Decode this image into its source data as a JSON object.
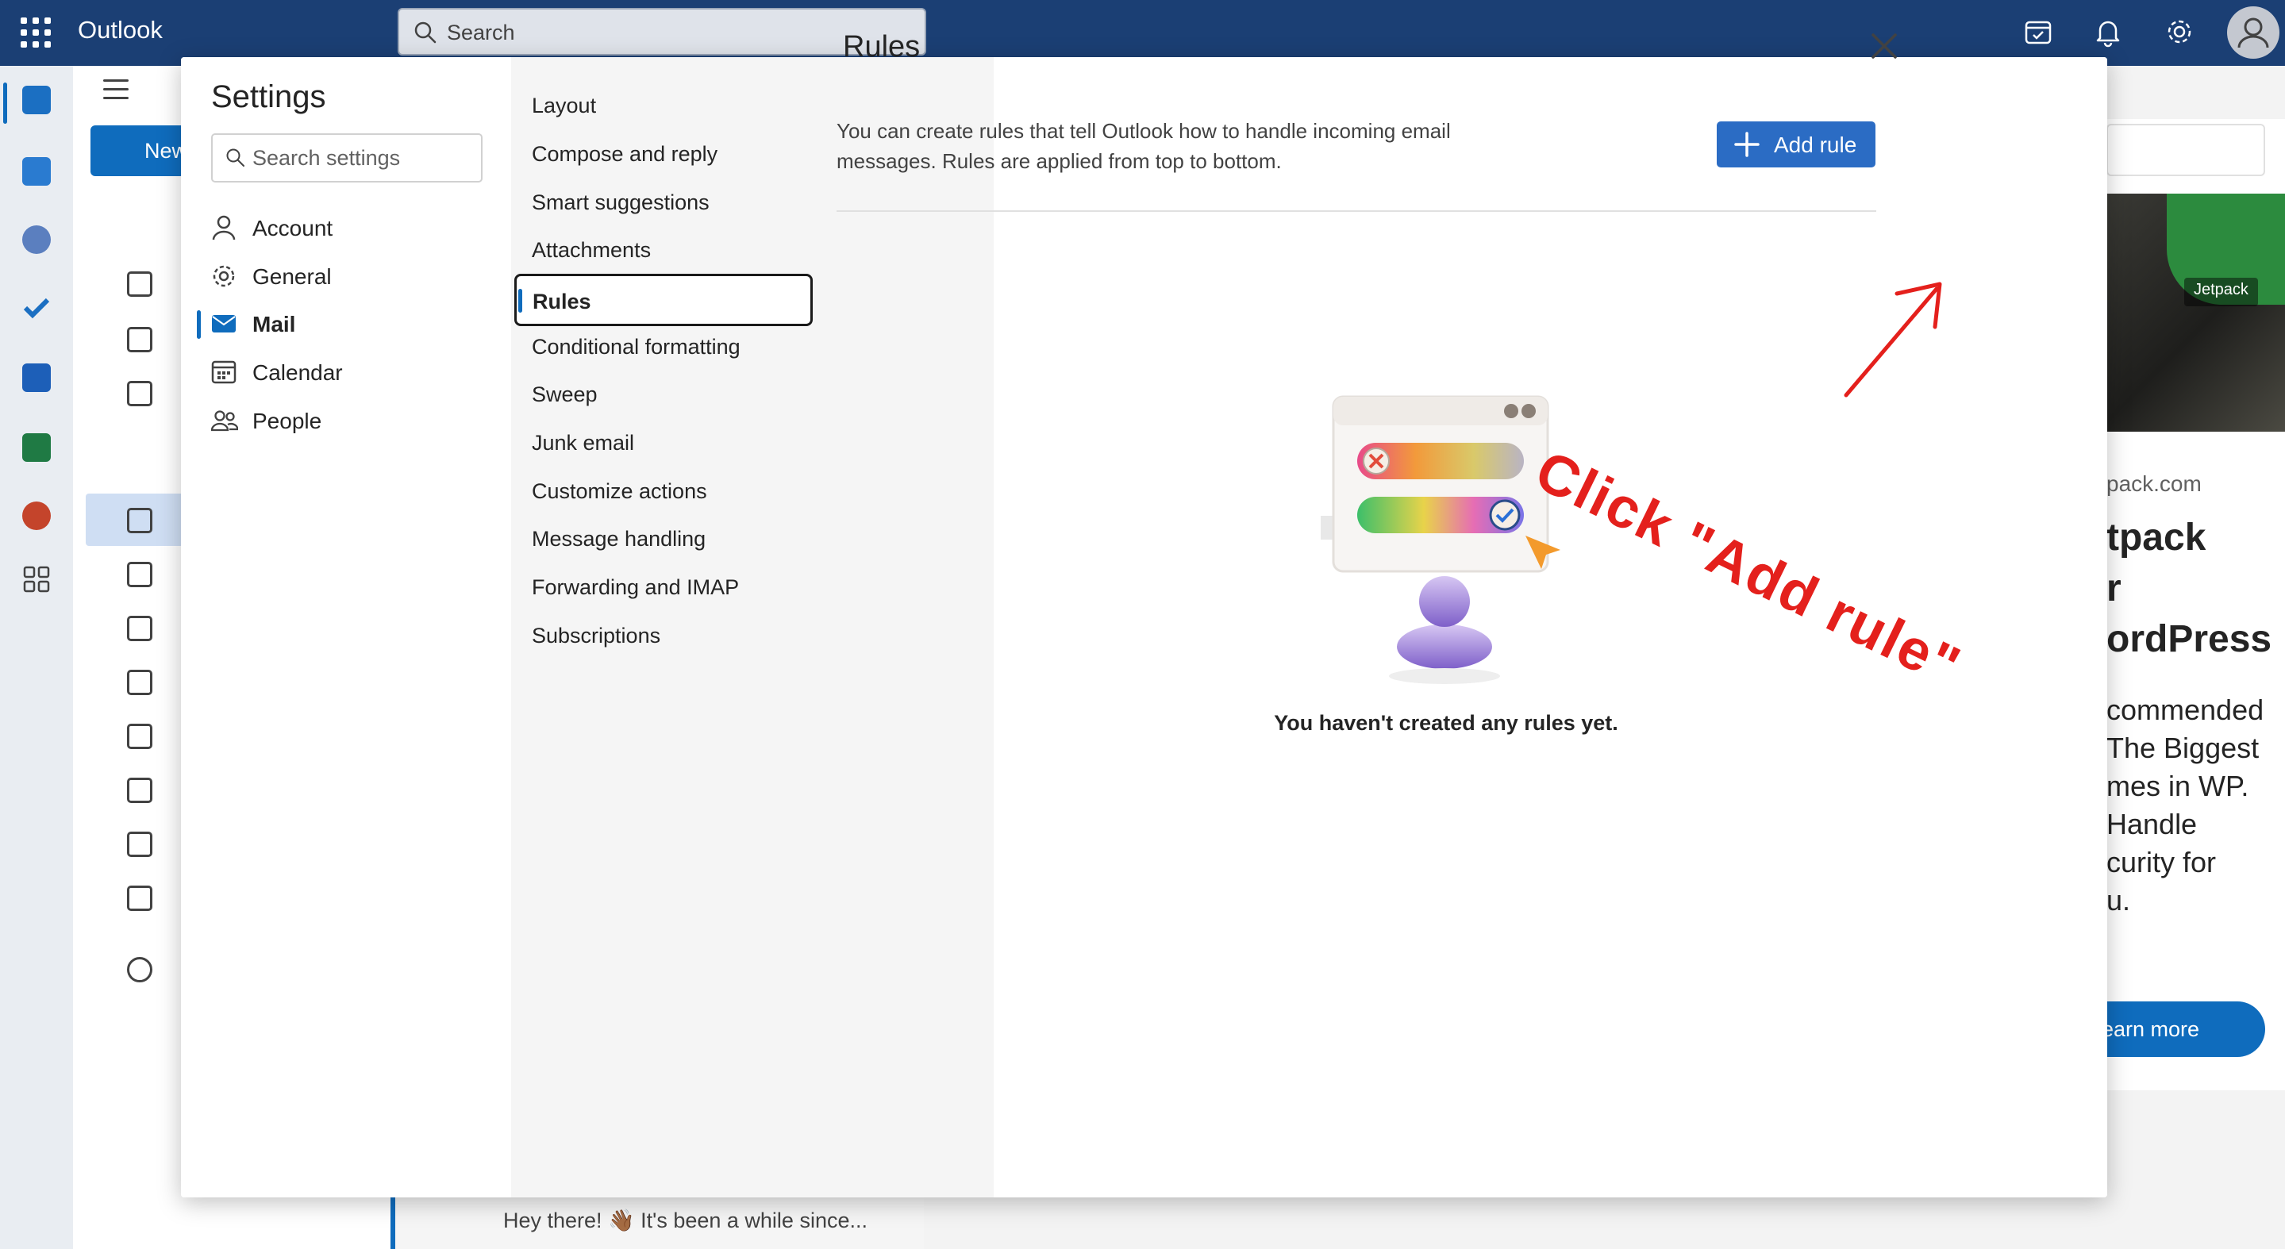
{
  "app": {
    "title": "Outlook",
    "search_placeholder": "Search"
  },
  "background": {
    "new_button_label": "New",
    "mail_snippet": "Hey there! 👋🏾 It's been a while since..."
  },
  "settings": {
    "title": "Settings",
    "search_placeholder": "Search settings",
    "categories": [
      {
        "label": "Account",
        "icon": "person-icon"
      },
      {
        "label": "General",
        "icon": "gear-icon"
      },
      {
        "label": "Mail",
        "icon": "mail-icon",
        "active": true
      },
      {
        "label": "Calendar",
        "icon": "calendar-icon"
      },
      {
        "label": "People",
        "icon": "people-icon"
      }
    ],
    "mail_subsections": [
      "Layout",
      "Compose and reply",
      "Smart suggestions",
      "Attachments",
      "Rules",
      "Conditional formatting",
      "Sweep",
      "Junk email",
      "Customize actions",
      "Message handling",
      "Forwarding and IMAP",
      "Subscriptions"
    ],
    "active_subsection": "Rules"
  },
  "rules": {
    "title": "Rules",
    "description_line1": "You can create rules that tell Outlook how to handle incoming email",
    "description_line2": "messages. Rules are applied from top to bottom.",
    "add_rule_label": "Add rule",
    "empty_text": "You haven't created any rules yet."
  },
  "annotation": {
    "text": "Click \"Add rule\"",
    "color": "#e4201c"
  },
  "ad": {
    "brand": "Jetpack",
    "domain": "pack.com",
    "headline_1": "tpack",
    "headline_2": "r",
    "headline_3": "ordPress",
    "body_1": "commended",
    "body_2": "The Biggest",
    "body_3": "mes in WP.",
    "body_4": "Handle",
    "body_5": "curity for",
    "body_6": "u.",
    "cta": "earn more"
  },
  "colors": {
    "topbar": "#1b3f74",
    "accent": "#0f6cbd",
    "add_rule_button": "#2b6cc4"
  }
}
